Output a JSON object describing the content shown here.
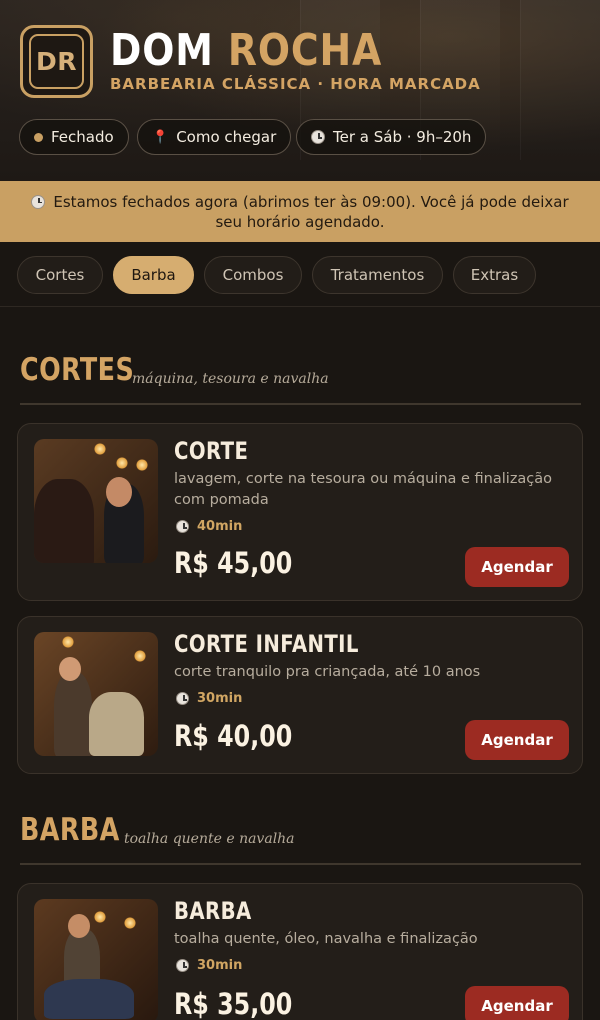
{
  "brand": {
    "logo_text": "DR",
    "name_part1": "DOM",
    "name_part2": "ROCHA",
    "tagline": "BARBEARIA CLÁSSICA · HORA MARCADA"
  },
  "status_pills": {
    "status": "Fechado",
    "directions": "Como chegar",
    "hours": "Ter a Sáb · 9h–20h"
  },
  "banner": {
    "text": "Estamos fechados agora (abrimos ter às 09:00). Você já pode deixar seu horário agendado."
  },
  "tabs": [
    {
      "label": "Cortes",
      "active": false
    },
    {
      "label": "Barba",
      "active": true
    },
    {
      "label": "Combos",
      "active": false
    },
    {
      "label": "Tratamentos",
      "active": false
    },
    {
      "label": "Extras",
      "active": false
    }
  ],
  "sections": [
    {
      "title": "CORTES",
      "subtitle": "máquina, tesoura e navalha",
      "services": [
        {
          "name": "CORTE",
          "description": "lavagem, corte na tesoura ou máquina e finalização com pomada",
          "duration": "40min",
          "price": "R$ 45,00",
          "button": "Agendar"
        },
        {
          "name": "CORTE INFANTIL",
          "description": "corte tranquilo pra criançada, até 10 anos",
          "duration": "30min",
          "price": "R$ 40,00",
          "button": "Agendar"
        }
      ]
    },
    {
      "title": "BARBA",
      "subtitle": "toalha quente e navalha",
      "services": [
        {
          "name": "BARBA",
          "description": "toalha quente, óleo, navalha e finalização",
          "duration": "30min",
          "price": "R$ 35,00",
          "button": "Agendar"
        }
      ]
    }
  ],
  "colors": {
    "accent": "#c9a063",
    "button": "#9c2b22",
    "background": "#1a1612",
    "card": "#231e19"
  }
}
